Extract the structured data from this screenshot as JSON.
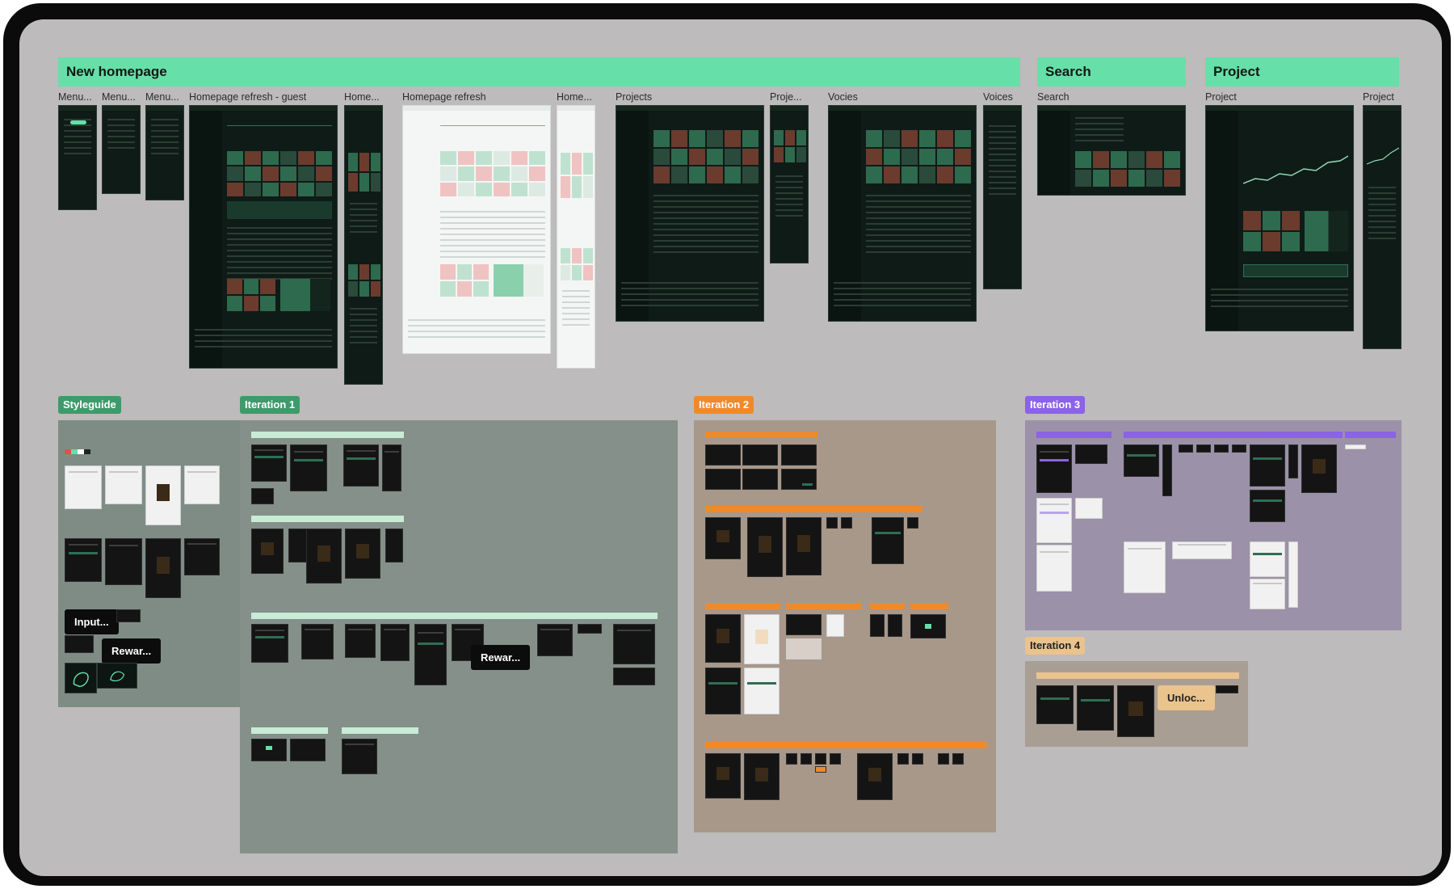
{
  "canvas": {
    "section_headers": {
      "new_homepage": "New homepage",
      "search": "Search",
      "project": "Project"
    },
    "frame_labels": {
      "menu_1": "Menu...",
      "menu_2": "Menu...",
      "menu_3": "Menu...",
      "homepage_refresh_guest": "Homepage refresh - guest",
      "home_1": "Home...",
      "homepage_refresh": "Homepage refresh",
      "home_2": "Home...",
      "projects": "Projects",
      "proje": "Proje...",
      "vocies": "Vocies",
      "voices": "Voices",
      "search": "Search",
      "project_1": "Project",
      "project_2": "Project"
    },
    "sections": {
      "styleguide": "Styleguide",
      "iteration_1": "Iteration 1",
      "iteration_2": "Iteration 2",
      "iteration_3": "Iteration 3",
      "iteration_4": "Iteration 4"
    },
    "overlay_labels": {
      "input": "Input...",
      "rewar_1": "Rewar...",
      "rewar_2": "Rewar...",
      "unloc": "Unloc..."
    },
    "colors": {
      "header_green": "#66dfa8",
      "styleguide_bg": "#7f8c86",
      "iteration_1_bg": "#849089",
      "iteration_2_bg": "#a8988a",
      "iteration_3_bg": "#9b91a8",
      "iteration_4_bg": "#a99e94",
      "tag_green": "#3f9a6b",
      "tag_orange": "#ef8a2c",
      "tag_purple": "#8a63e6",
      "tag_beige": "#eac38d"
    }
  }
}
